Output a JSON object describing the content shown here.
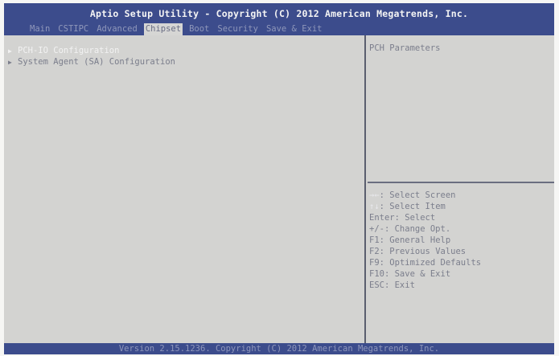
{
  "title": "Aptio Setup Utility - Copyright (C) 2012 American Megatrends, Inc.",
  "tabs": [
    {
      "label": "Main"
    },
    {
      "label": "CSTIPC"
    },
    {
      "label": "Advanced"
    },
    {
      "label": "Chipset"
    },
    {
      "label": "Boot"
    },
    {
      "label": "Security"
    },
    {
      "label": "Save & Exit"
    }
  ],
  "active_tab": "Chipset",
  "menu": {
    "items": [
      {
        "label": "PCH-IO Configuration",
        "selected": true
      },
      {
        "label": "System Agent (SA) Configuration",
        "selected": false
      }
    ]
  },
  "help": {
    "description": "PCH Parameters",
    "keys": [
      {
        "key": "→←",
        "desc": ": Select Screen"
      },
      {
        "key": "↑↓",
        "desc": ": Select Item"
      },
      {
        "key": "Enter",
        "desc": ": Select"
      },
      {
        "key": "+/-",
        "desc": ": Change Opt."
      },
      {
        "key": "F1",
        "desc": ": General Help"
      },
      {
        "key": "F2",
        "desc": ": Previous Values"
      },
      {
        "key": "F9",
        "desc": ": Optimized Defaults"
      },
      {
        "key": "F10",
        "desc": ": Save & Exit"
      },
      {
        "key": "ESC",
        "desc": ": Exit"
      }
    ]
  },
  "status": "Version 2.15.1236. Copyright (C) 2012 American Megatrends, Inc.",
  "colors": {
    "title_bar": "#3c4c8c",
    "panel": "#d3d3d1",
    "text": "#7b7e8c",
    "highlight": "#f2f2f2"
  },
  "icons": {
    "submenu": "submenu-arrow-icon"
  }
}
